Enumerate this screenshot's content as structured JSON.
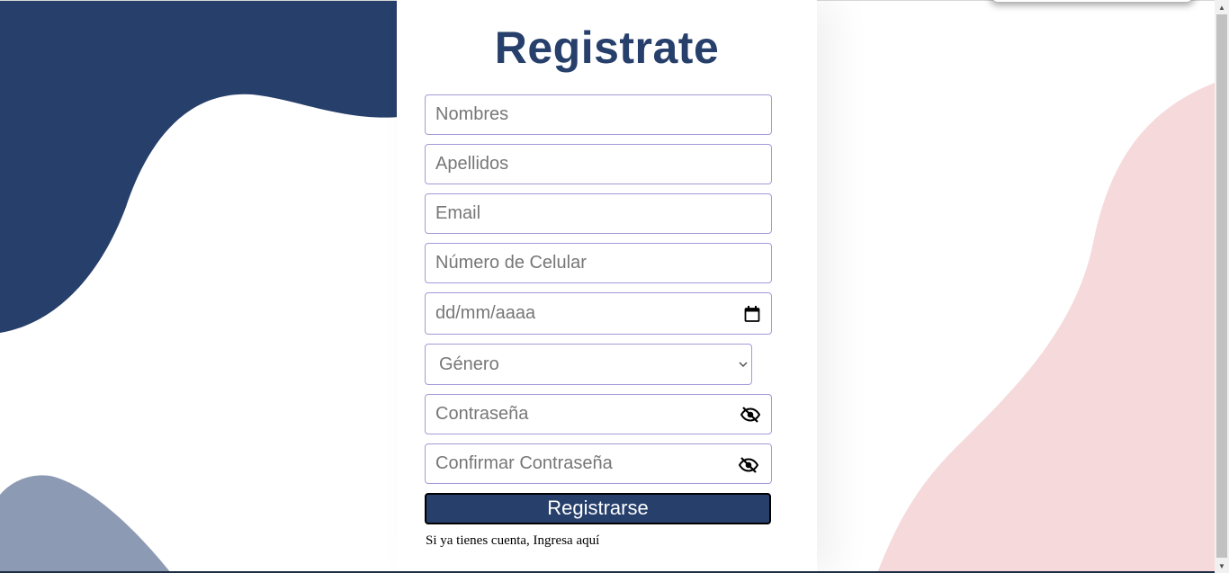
{
  "colors": {
    "navy": "#273f6b",
    "slate": "#8d9ab4",
    "pink": "#f6d9db",
    "field_border": "#a49ad8"
  },
  "form": {
    "title": "Registrate",
    "nombres_placeholder": "Nombres",
    "apellidos_placeholder": "Apellidos",
    "email_placeholder": "Email",
    "celular_placeholder": "Número de Celular",
    "fecha_placeholder": "dd/mm/aaaa",
    "genero_selected": "Género",
    "password_placeholder": "Contraseña",
    "confirm_password_placeholder": "Confirmar Contraseña",
    "submit_label": "Registrarse",
    "login_prompt": "Si ya tienes cuenta, Ingresa aquí"
  },
  "icons": {
    "date": "calendar-icon",
    "select": "chevron-down-icon",
    "password_toggle": "eye-off-icon"
  }
}
